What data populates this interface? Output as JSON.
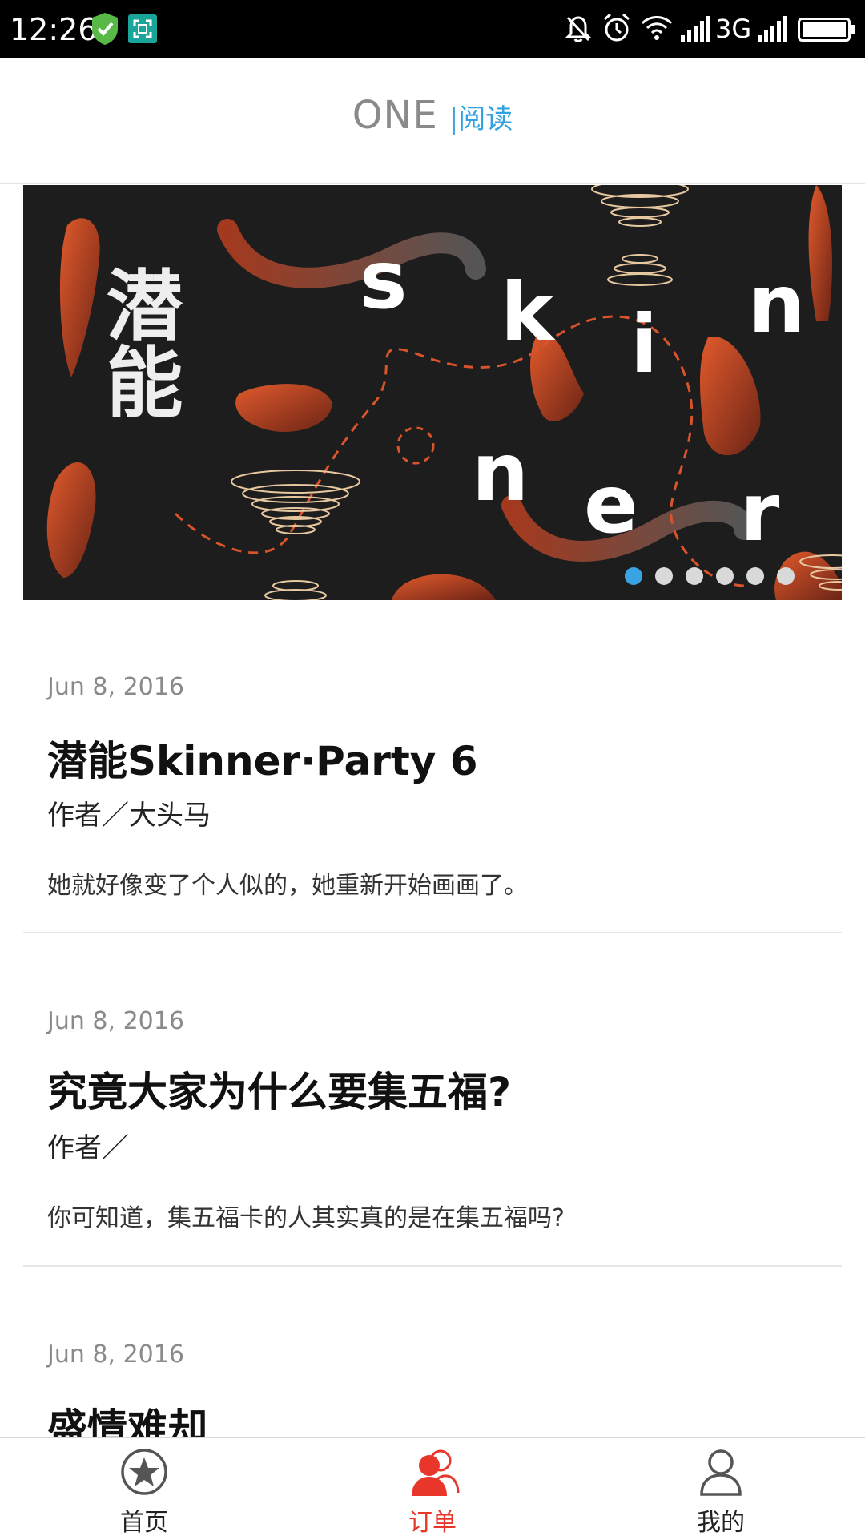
{
  "status_bar": {
    "time": "12:26",
    "network": "3G"
  },
  "header": {
    "logo_one": "ONE",
    "logo_section": "|阅读"
  },
  "banner": {
    "title_cn": "潜能",
    "letters": [
      "s",
      "k",
      "i",
      "n",
      "n",
      "e",
      "r"
    ],
    "dots_total": 6,
    "active_dot": 0,
    "accent": "#d9542b"
  },
  "articles": [
    {
      "date": "Jun 8, 2016",
      "title": "潜能Skinner·Party 6",
      "author": "作者／大头马",
      "excerpt": "她就好像变了个人似的，她重新开始画画了。"
    },
    {
      "date": "Jun 8, 2016",
      "title": "究竟大家为什么要集五福?",
      "author": "作者／",
      "excerpt": "你可知道，集五福卡的人其实真的是在集五福吗?"
    },
    {
      "date": "Jun 8, 2016",
      "title": "盛情难却"
    }
  ],
  "bottom_nav": {
    "items": [
      {
        "label": "首页",
        "icon": "star-circle-icon"
      },
      {
        "label": "订单",
        "icon": "people-icon",
        "active": true
      },
      {
        "label": "我的",
        "icon": "person-icon"
      }
    ],
    "active_color": "#e8362b"
  }
}
